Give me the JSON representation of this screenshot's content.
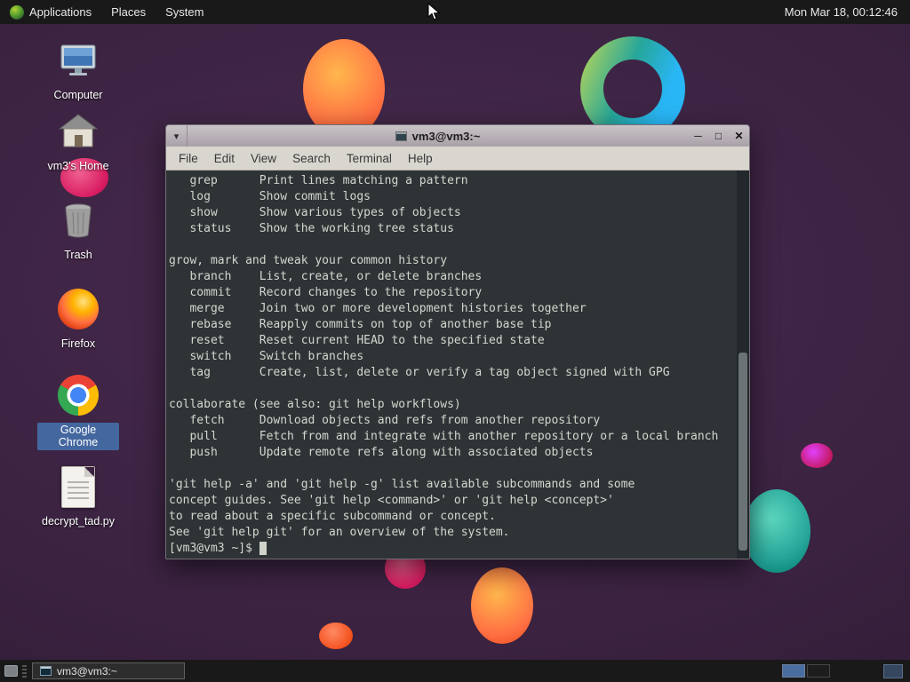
{
  "colors": {
    "selection_accent": "#44679f",
    "terminal_bg": "#2e3436",
    "terminal_fg": "#d3d7cf",
    "panel_bg": "#191919",
    "titlebar": "#b5aeb4"
  },
  "top_panel": {
    "menus": [
      {
        "label": "Applications"
      },
      {
        "label": "Places"
      },
      {
        "label": "System"
      }
    ],
    "clock": "Mon Mar 18, 00:12:46"
  },
  "desktop_icons": [
    {
      "label": "Computer"
    },
    {
      "label": "vm3's Home"
    },
    {
      "label": "Trash"
    },
    {
      "label": "Firefox"
    },
    {
      "label": "Google Chrome"
    },
    {
      "label": "decrypt_tad.py"
    }
  ],
  "terminal_window": {
    "title": "vm3@vm3:~",
    "controls": {
      "menu_chevron": "▾",
      "minimize": "─",
      "maximize": "□",
      "close": "✕"
    },
    "menu_items": [
      "File",
      "Edit",
      "View",
      "Search",
      "Terminal",
      "Help"
    ],
    "output_lines": [
      "   grep      Print lines matching a pattern",
      "   log       Show commit logs",
      "   show      Show various types of objects",
      "   status    Show the working tree status",
      "",
      "grow, mark and tweak your common history",
      "   branch    List, create, or delete branches",
      "   commit    Record changes to the repository",
      "   merge     Join two or more development histories together",
      "   rebase    Reapply commits on top of another base tip",
      "   reset     Reset current HEAD to the specified state",
      "   switch    Switch branches",
      "   tag       Create, list, delete or verify a tag object signed with GPG",
      "",
      "collaborate (see also: git help workflows)",
      "   fetch     Download objects and refs from another repository",
      "   pull      Fetch from and integrate with another repository or a local branch",
      "   push      Update remote refs along with associated objects",
      "",
      "'git help -a' and 'git help -g' list available subcommands and some",
      "concept guides. See 'git help <command>' or 'git help <concept>'",
      "to read about a specific subcommand or concept.",
      "See 'git help git' for an overview of the system."
    ],
    "prompt": "[vm3@vm3 ~]$ "
  },
  "taskbar": {
    "window_button_label": "vm3@vm3:~"
  }
}
